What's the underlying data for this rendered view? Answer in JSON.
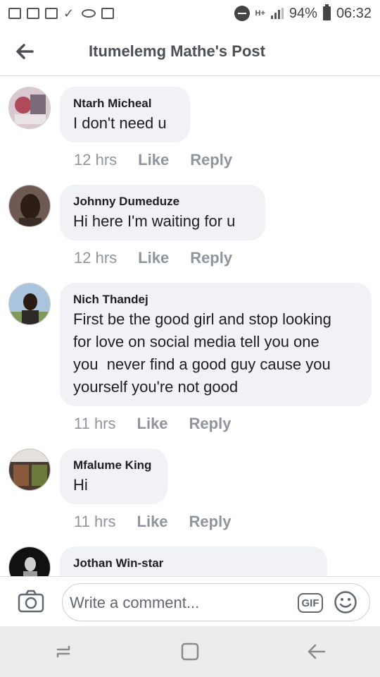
{
  "status_bar": {
    "battery": "94%",
    "time": "06:32",
    "network": "H+"
  },
  "header": {
    "title": "Itumelemg Mathe's Post"
  },
  "comments": [
    {
      "author": "Ntarh Micheal",
      "text": "I don't need u",
      "time": "12 hrs",
      "like": "Like",
      "reply": "Reply"
    },
    {
      "author": "Johnny Dumeduze",
      "text": "Hi here I'm waiting for u",
      "time": "12 hrs",
      "like": "Like",
      "reply": "Reply"
    },
    {
      "author": "Nich Thandej",
      "text": "First be the good girl and stop looking\nfor love on social media tell you one\nyou  never find a good guy cause you\nyourself you're not good",
      "time": "11 hrs",
      "like": "Like",
      "reply": "Reply"
    },
    {
      "author": "Mfalume King",
      "text": "Hi",
      "time": "11 hrs",
      "like": "Like",
      "reply": "Reply"
    },
    {
      "author": "Jothan Win-star",
      "text": ""
    }
  ],
  "composer": {
    "placeholder": "Write a comment...",
    "gif_label": "GIF"
  },
  "colors": {
    "bubble": "#f0f2f5",
    "meta_text": "#90949c",
    "title_text": "#4b4f56"
  }
}
